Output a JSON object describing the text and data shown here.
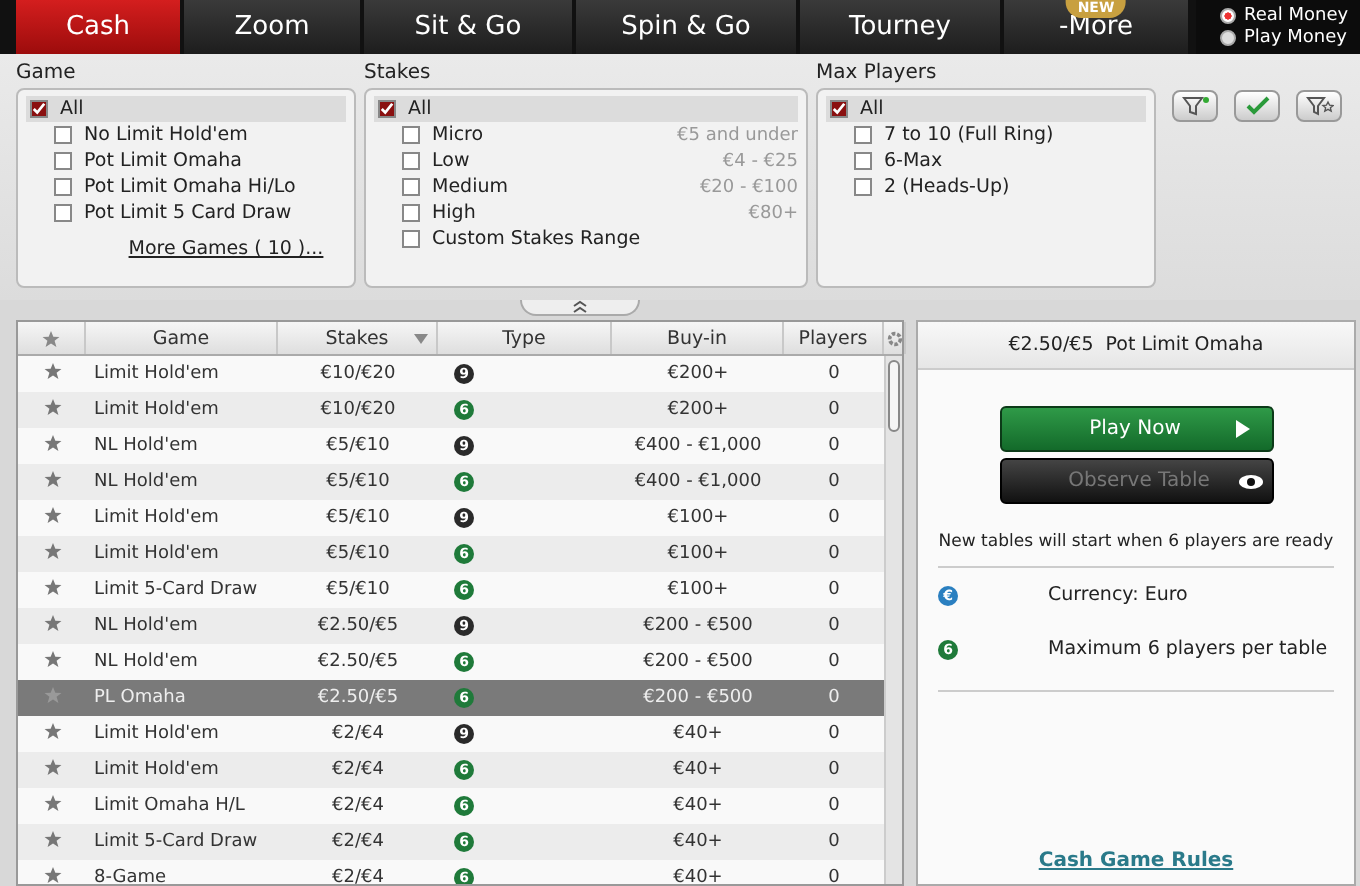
{
  "tabs": [
    {
      "label": "Cash",
      "selected": true
    },
    {
      "label": "Zoom",
      "selected": false
    },
    {
      "label": "Sit & Go",
      "selected": false
    },
    {
      "label": "Spin & Go",
      "selected": false
    },
    {
      "label": "Tourney",
      "selected": false
    },
    {
      "label": "-More",
      "selected": false,
      "badge": "NEW"
    }
  ],
  "money_mode": [
    {
      "label": "Real Money",
      "selected": true
    },
    {
      "label": "Play Money",
      "selected": false
    }
  ],
  "filters": [
    {
      "title": "Game",
      "options": [
        {
          "label": "All",
          "checked": true
        },
        {
          "label": "No Limit Hold'em",
          "checked": false
        },
        {
          "label": "Pot Limit Omaha",
          "checked": false
        },
        {
          "label": "Pot Limit Omaha Hi/Lo",
          "checked": false
        },
        {
          "label": "Pot Limit 5 Card Draw",
          "checked": false
        }
      ],
      "link": "More Games ( 10 )..."
    },
    {
      "title": "Stakes",
      "options": [
        {
          "label": "All",
          "checked": true
        },
        {
          "label": "Micro",
          "checked": false,
          "note": "€5 and under"
        },
        {
          "label": "Low",
          "checked": false,
          "note": "€4 - €25"
        },
        {
          "label": "Medium",
          "checked": false,
          "note": "€20 - €100"
        },
        {
          "label": "High",
          "checked": false,
          "note": "€80+"
        },
        {
          "label": "Custom Stakes Range",
          "checked": false
        }
      ]
    },
    {
      "title": "Max Players",
      "options": [
        {
          "label": "All",
          "checked": true
        },
        {
          "label": "7 to 10 (Full Ring)",
          "checked": false
        },
        {
          "label": "6-Max",
          "checked": false
        },
        {
          "label": "2 (Heads-Up)",
          "checked": false
        }
      ]
    }
  ],
  "table": {
    "columns": [
      "Game",
      "Stakes",
      "Type",
      "Buy-in",
      "Players"
    ],
    "rows": [
      {
        "game": "Limit Hold'em",
        "stakes": "€10/€20",
        "type": "9",
        "color": "#2a2a2a",
        "buyin": "€200+",
        "players": "0",
        "selected": false
      },
      {
        "game": "Limit Hold'em",
        "stakes": "€10/€20",
        "type": "6",
        "color": "#1f7a3a",
        "buyin": "€200+",
        "players": "0",
        "selected": false
      },
      {
        "game": "NL Hold'em",
        "stakes": "€5/€10",
        "type": "9",
        "color": "#2a2a2a",
        "buyin": "€400 - €1,000",
        "players": "0",
        "selected": false
      },
      {
        "game": "NL Hold'em",
        "stakes": "€5/€10",
        "type": "6",
        "color": "#1f7a3a",
        "buyin": "€400 - €1,000",
        "players": "0",
        "selected": false
      },
      {
        "game": "Limit Hold'em",
        "stakes": "€5/€10",
        "type": "9",
        "color": "#2a2a2a",
        "buyin": "€100+",
        "players": "0",
        "selected": false
      },
      {
        "game": "Limit Hold'em",
        "stakes": "€5/€10",
        "type": "6",
        "color": "#1f7a3a",
        "buyin": "€100+",
        "players": "0",
        "selected": false
      },
      {
        "game": "Limit 5-Card Draw",
        "stakes": "€5/€10",
        "type": "6",
        "color": "#1f7a3a",
        "buyin": "€100+",
        "players": "0",
        "selected": false
      },
      {
        "game": "NL Hold'em",
        "stakes": "€2.50/€5",
        "type": "9",
        "color": "#2a2a2a",
        "buyin": "€200 - €500",
        "players": "0",
        "selected": false
      },
      {
        "game": "NL Hold'em",
        "stakes": "€2.50/€5",
        "type": "6",
        "color": "#1f7a3a",
        "buyin": "€200 - €500",
        "players": "0",
        "selected": false
      },
      {
        "game": "PL Omaha",
        "stakes": "€2.50/€5",
        "type": "6",
        "color": "#1f7a3a",
        "buyin": "€200 - €500",
        "players": "0",
        "selected": true
      },
      {
        "game": "Limit Hold'em",
        "stakes": "€2/€4",
        "type": "9",
        "color": "#2a2a2a",
        "buyin": "€40+",
        "players": "0",
        "selected": false
      },
      {
        "game": "Limit Hold'em",
        "stakes": "€2/€4",
        "type": "6",
        "color": "#1f7a3a",
        "buyin": "€40+",
        "players": "0",
        "selected": false
      },
      {
        "game": "Limit Omaha H/L",
        "stakes": "€2/€4",
        "type": "6",
        "color": "#1f7a3a",
        "buyin": "€40+",
        "players": "0",
        "selected": false
      },
      {
        "game": "Limit 5-Card Draw",
        "stakes": "€2/€4",
        "type": "6",
        "color": "#1f7a3a",
        "buyin": "€40+",
        "players": "0",
        "selected": false
      },
      {
        "game": "8-Game",
        "stakes": "€2/€4",
        "type": "6",
        "color": "#1f7a3a",
        "buyin": "€40+",
        "players": "0",
        "selected": false
      }
    ]
  },
  "details": {
    "title": "€2.50/€5  Pot Limit Omaha",
    "play_button": "Play Now",
    "observe_button": "Observe Table",
    "message": "New tables will start when 6 players are ready",
    "info": [
      {
        "badge": "€",
        "color": "#2a7fc0",
        "text": "Currency: Euro"
      },
      {
        "badge": "6",
        "color": "#1f7a3a",
        "text": "Maximum 6 players per table"
      }
    ],
    "rules_link": "Cash Game Rules"
  }
}
